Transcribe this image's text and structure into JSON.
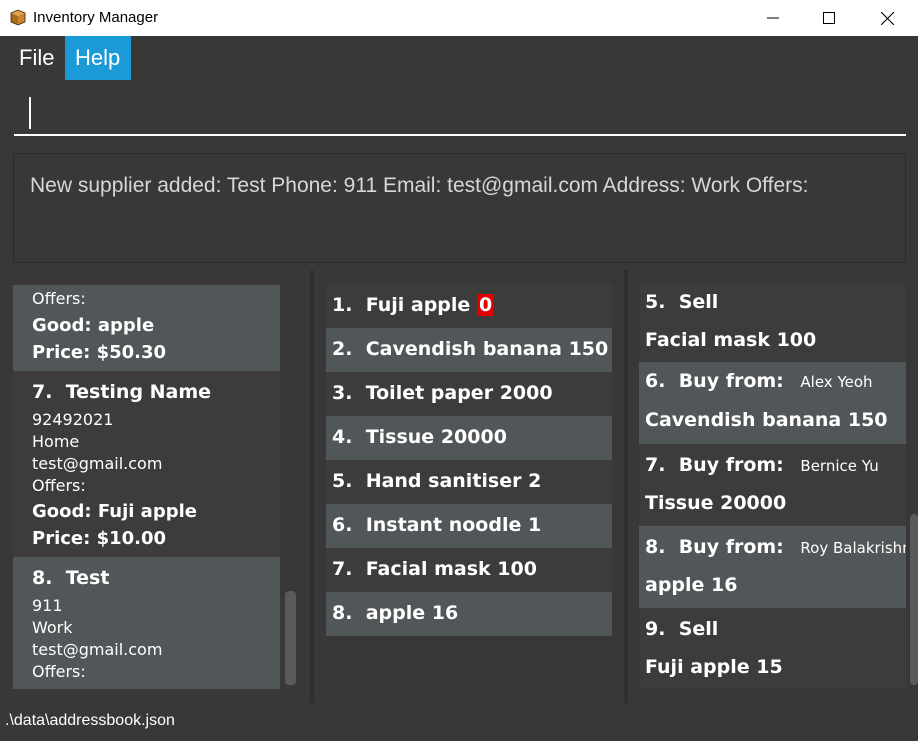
{
  "window": {
    "title": "Inventory Manager",
    "icon": "box-icon"
  },
  "menu": {
    "file": "File",
    "help": "Help"
  },
  "command": {
    "value": ""
  },
  "result": {
    "text": "New supplier added: Test Phone: 911 Email: test@gmail.com Address: Work Offers:"
  },
  "suppliers": {
    "partial_top": {
      "offers_label": "Offers:",
      "good": "Good: apple",
      "price": "Price: $50.30"
    },
    "items": [
      {
        "index": "7.",
        "name": "Testing Name",
        "phone": "92492021",
        "address": "Home",
        "email": "test@gmail.com",
        "offers_label": "Offers:",
        "good": "Good: Fuji apple",
        "price": "Price: $10.00"
      },
      {
        "index": "8.",
        "name": "Test",
        "phone": "911",
        "address": "Work",
        "email": "test@gmail.com",
        "offers_label": "Offers:"
      }
    ]
  },
  "goods": [
    {
      "index": "1.",
      "name": "Fuji apple",
      "qty": "0",
      "low": true
    },
    {
      "index": "2.",
      "name": "Cavendish banana",
      "qty": "150"
    },
    {
      "index": "3.",
      "name": "Toilet paper",
      "qty": "2000"
    },
    {
      "index": "4.",
      "name": "Tissue",
      "qty": "20000"
    },
    {
      "index": "5.",
      "name": "Hand sanitiser",
      "qty": "2"
    },
    {
      "index": "6.",
      "name": "Instant noodle",
      "qty": "1"
    },
    {
      "index": "7.",
      "name": "Facial mask",
      "qty": "100"
    },
    {
      "index": "8.",
      "name": "apple",
      "qty": "16"
    }
  ],
  "transactions": [
    {
      "index": "5.",
      "type": "Sell",
      "supplier": "",
      "good": "Facial mask 100"
    },
    {
      "index": "6.",
      "type": "Buy from:",
      "supplier": "Alex Yeoh",
      "good": "Cavendish banana 150"
    },
    {
      "index": "7.",
      "type": "Buy from:",
      "supplier": "Bernice Yu",
      "good": "Tissue 20000"
    },
    {
      "index": "8.",
      "type": "Buy from:",
      "supplier": "Roy Balakrishnan",
      "good": "apple 16"
    },
    {
      "index": "9.",
      "type": "Sell",
      "supplier": "",
      "good": "Fuji apple 15"
    }
  ],
  "status": {
    "path": ".\\data\\addressbook.json"
  },
  "colors": {
    "background": "#383838",
    "card_light": "#515658",
    "accent": "#1a9bd7",
    "low_stock": "#e00000"
  }
}
